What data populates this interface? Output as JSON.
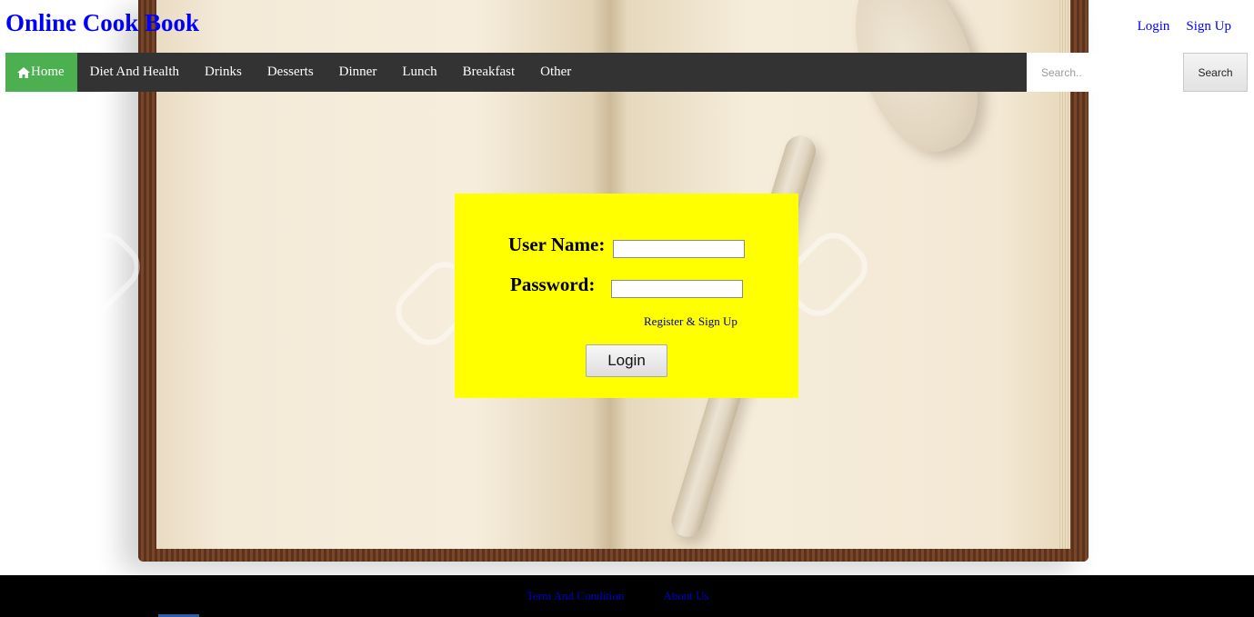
{
  "header": {
    "site_title": "Online Cook Book",
    "top_links": {
      "login": "Login",
      "signup": "Sign Up"
    }
  },
  "nav": {
    "items": [
      {
        "label": "Home",
        "icon": "home-icon",
        "active": true
      },
      {
        "label": "Diet And Health"
      },
      {
        "label": "Drinks"
      },
      {
        "label": "Desserts"
      },
      {
        "label": "Dinner"
      },
      {
        "label": "Lunch"
      },
      {
        "label": "Breakfast"
      },
      {
        "label": "Other"
      }
    ],
    "search": {
      "placeholder": "Search..",
      "button_label": "Search"
    },
    "active_color": "#4caf50",
    "bar_color": "#333333"
  },
  "login_form": {
    "username_label": "User Name:",
    "password_label": "Password:",
    "register_link": "Register & Sign Up",
    "submit_label": "Login",
    "panel_color": "#ffff00"
  },
  "footer": {
    "links": {
      "terms": "Term And Condition",
      "about": "About Us"
    }
  }
}
